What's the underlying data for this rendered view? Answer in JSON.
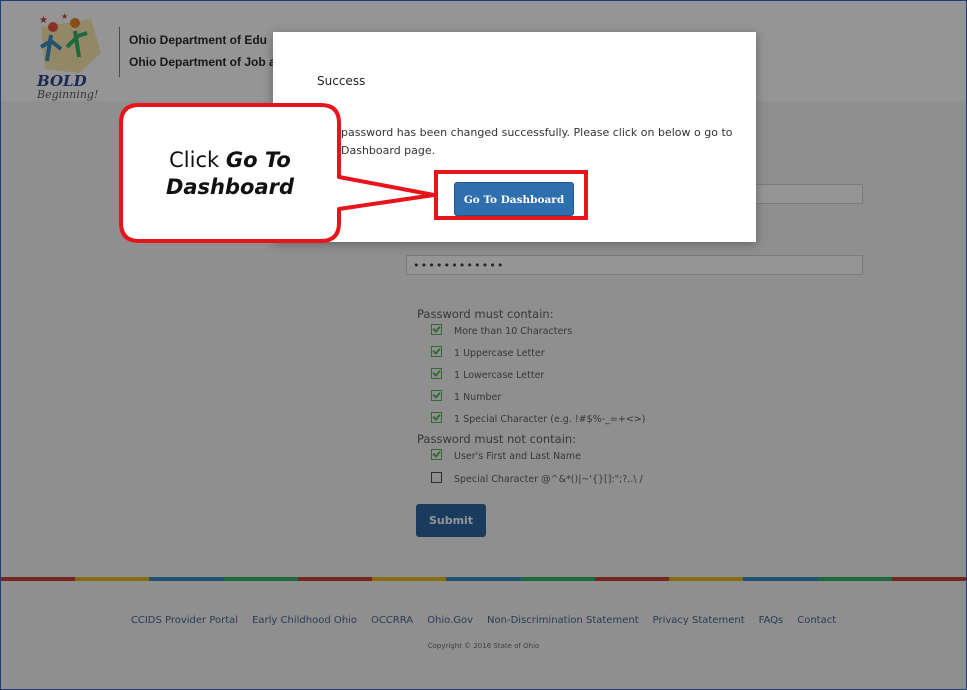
{
  "header": {
    "logo_main": "BOLD",
    "logo_sub": "Beginning!",
    "dept_line1": "Ohio Department of Edu",
    "dept_line2": "Ohio Department of Job a"
  },
  "form": {
    "masked_value": "••••••••••••",
    "requirements_title": "Password must contain:",
    "requirements": [
      {
        "text": "More than 10 Characters",
        "checked": true
      },
      {
        "text": "1 Uppercase Letter",
        "checked": true
      },
      {
        "text": "1 Lowercase Letter",
        "checked": true
      },
      {
        "text": "1 Number",
        "checked": true
      },
      {
        "text": "1 Special Character (e.g. !#$%-_=+<>)",
        "checked": true
      }
    ],
    "exclusions_title": "Password must not contain:",
    "exclusions": [
      {
        "text": "User's First and Last Name",
        "checked": true
      },
      {
        "text": "Special Character @^&*()|~'{}[]:\";?,.\\ /",
        "checked": false
      }
    ],
    "submit_label": "Submit"
  },
  "footer": {
    "links": [
      "CCIDS Provider Portal",
      "Early Childhood Ohio",
      "OCCRRA",
      "Ohio.Gov",
      "Non-Discrimination Statement",
      "Privacy Statement",
      "FAQs",
      "Contact"
    ],
    "copyright": "Copyright © 2016 State of Ohio",
    "stripe_colors": [
      "#c0392b",
      "#e8b400",
      "#2e86c1",
      "#27ae60",
      "#c0392b",
      "#e8b400",
      "#2e86c1",
      "#27ae60",
      "#c0392b",
      "#e8b400",
      "#2e86c1",
      "#27ae60",
      "#c0392b"
    ]
  },
  "modal": {
    "title": "Success",
    "message": "password has been changed successfully. Please click on below o go to Dashboard page.",
    "button_label": "Go To Dashboard"
  },
  "callout": {
    "line1": "Click ",
    "line1_bold": "Go To",
    "line2_bold": "Dashboard",
    "border_color": "#e8141b"
  }
}
